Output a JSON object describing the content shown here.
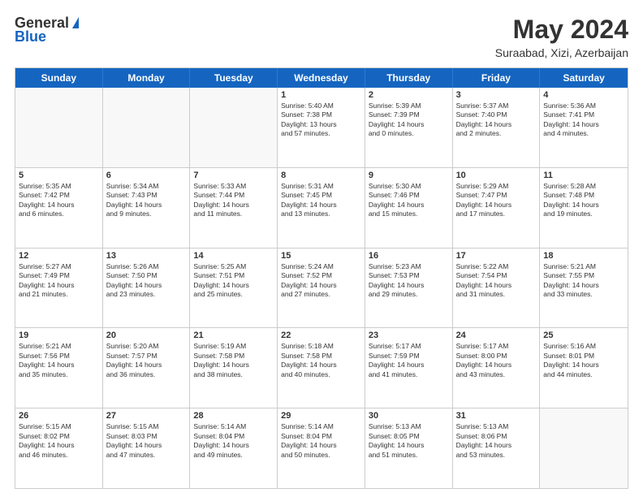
{
  "logo": {
    "general": "General",
    "blue": "Blue"
  },
  "title": "May 2024",
  "location": "Suraabad, Xizi, Azerbaijan",
  "weekdays": [
    "Sunday",
    "Monday",
    "Tuesday",
    "Wednesday",
    "Thursday",
    "Friday",
    "Saturday"
  ],
  "rows": [
    [
      {
        "day": "",
        "info": ""
      },
      {
        "day": "",
        "info": ""
      },
      {
        "day": "",
        "info": ""
      },
      {
        "day": "1",
        "info": "Sunrise: 5:40 AM\nSunset: 7:38 PM\nDaylight: 13 hours\nand 57 minutes."
      },
      {
        "day": "2",
        "info": "Sunrise: 5:39 AM\nSunset: 7:39 PM\nDaylight: 14 hours\nand 0 minutes."
      },
      {
        "day": "3",
        "info": "Sunrise: 5:37 AM\nSunset: 7:40 PM\nDaylight: 14 hours\nand 2 minutes."
      },
      {
        "day": "4",
        "info": "Sunrise: 5:36 AM\nSunset: 7:41 PM\nDaylight: 14 hours\nand 4 minutes."
      }
    ],
    [
      {
        "day": "5",
        "info": "Sunrise: 5:35 AM\nSunset: 7:42 PM\nDaylight: 14 hours\nand 6 minutes."
      },
      {
        "day": "6",
        "info": "Sunrise: 5:34 AM\nSunset: 7:43 PM\nDaylight: 14 hours\nand 9 minutes."
      },
      {
        "day": "7",
        "info": "Sunrise: 5:33 AM\nSunset: 7:44 PM\nDaylight: 14 hours\nand 11 minutes."
      },
      {
        "day": "8",
        "info": "Sunrise: 5:31 AM\nSunset: 7:45 PM\nDaylight: 14 hours\nand 13 minutes."
      },
      {
        "day": "9",
        "info": "Sunrise: 5:30 AM\nSunset: 7:46 PM\nDaylight: 14 hours\nand 15 minutes."
      },
      {
        "day": "10",
        "info": "Sunrise: 5:29 AM\nSunset: 7:47 PM\nDaylight: 14 hours\nand 17 minutes."
      },
      {
        "day": "11",
        "info": "Sunrise: 5:28 AM\nSunset: 7:48 PM\nDaylight: 14 hours\nand 19 minutes."
      }
    ],
    [
      {
        "day": "12",
        "info": "Sunrise: 5:27 AM\nSunset: 7:49 PM\nDaylight: 14 hours\nand 21 minutes."
      },
      {
        "day": "13",
        "info": "Sunrise: 5:26 AM\nSunset: 7:50 PM\nDaylight: 14 hours\nand 23 minutes."
      },
      {
        "day": "14",
        "info": "Sunrise: 5:25 AM\nSunset: 7:51 PM\nDaylight: 14 hours\nand 25 minutes."
      },
      {
        "day": "15",
        "info": "Sunrise: 5:24 AM\nSunset: 7:52 PM\nDaylight: 14 hours\nand 27 minutes."
      },
      {
        "day": "16",
        "info": "Sunrise: 5:23 AM\nSunset: 7:53 PM\nDaylight: 14 hours\nand 29 minutes."
      },
      {
        "day": "17",
        "info": "Sunrise: 5:22 AM\nSunset: 7:54 PM\nDaylight: 14 hours\nand 31 minutes."
      },
      {
        "day": "18",
        "info": "Sunrise: 5:21 AM\nSunset: 7:55 PM\nDaylight: 14 hours\nand 33 minutes."
      }
    ],
    [
      {
        "day": "19",
        "info": "Sunrise: 5:21 AM\nSunset: 7:56 PM\nDaylight: 14 hours\nand 35 minutes."
      },
      {
        "day": "20",
        "info": "Sunrise: 5:20 AM\nSunset: 7:57 PM\nDaylight: 14 hours\nand 36 minutes."
      },
      {
        "day": "21",
        "info": "Sunrise: 5:19 AM\nSunset: 7:58 PM\nDaylight: 14 hours\nand 38 minutes."
      },
      {
        "day": "22",
        "info": "Sunrise: 5:18 AM\nSunset: 7:58 PM\nDaylight: 14 hours\nand 40 minutes."
      },
      {
        "day": "23",
        "info": "Sunrise: 5:17 AM\nSunset: 7:59 PM\nDaylight: 14 hours\nand 41 minutes."
      },
      {
        "day": "24",
        "info": "Sunrise: 5:17 AM\nSunset: 8:00 PM\nDaylight: 14 hours\nand 43 minutes."
      },
      {
        "day": "25",
        "info": "Sunrise: 5:16 AM\nSunset: 8:01 PM\nDaylight: 14 hours\nand 44 minutes."
      }
    ],
    [
      {
        "day": "26",
        "info": "Sunrise: 5:15 AM\nSunset: 8:02 PM\nDaylight: 14 hours\nand 46 minutes."
      },
      {
        "day": "27",
        "info": "Sunrise: 5:15 AM\nSunset: 8:03 PM\nDaylight: 14 hours\nand 47 minutes."
      },
      {
        "day": "28",
        "info": "Sunrise: 5:14 AM\nSunset: 8:04 PM\nDaylight: 14 hours\nand 49 minutes."
      },
      {
        "day": "29",
        "info": "Sunrise: 5:14 AM\nSunset: 8:04 PM\nDaylight: 14 hours\nand 50 minutes."
      },
      {
        "day": "30",
        "info": "Sunrise: 5:13 AM\nSunset: 8:05 PM\nDaylight: 14 hours\nand 51 minutes."
      },
      {
        "day": "31",
        "info": "Sunrise: 5:13 AM\nSunset: 8:06 PM\nDaylight: 14 hours\nand 53 minutes."
      },
      {
        "day": "",
        "info": ""
      }
    ]
  ]
}
